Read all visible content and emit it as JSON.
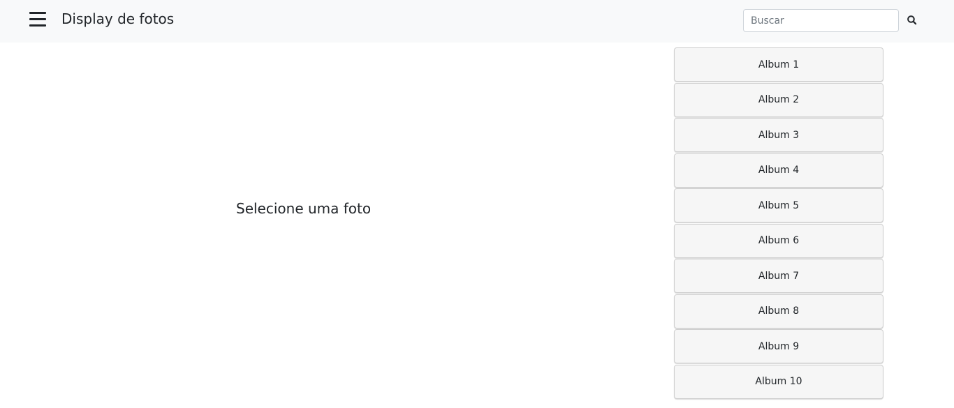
{
  "navbar": {
    "menu_icon": "hamburger-menu-icon",
    "title": "Display de fotos",
    "search": {
      "placeholder": "Buscar",
      "value": "",
      "icon": "search-icon"
    }
  },
  "main": {
    "placeholder_text": "Selecione uma foto"
  },
  "albums": [
    {
      "label": "Album 1"
    },
    {
      "label": "Album 2"
    },
    {
      "label": "Album 3"
    },
    {
      "label": "Album 4"
    },
    {
      "label": "Album 5"
    },
    {
      "label": "Album 6"
    },
    {
      "label": "Album 7"
    },
    {
      "label": "Album 8"
    },
    {
      "label": "Album 9"
    },
    {
      "label": "Album 10"
    }
  ],
  "colors": {
    "navbar_bg": "#f8f9fa",
    "text": "#212529",
    "album_button_bg": "#f6f6f6",
    "album_button_border": "#cfcfcf"
  }
}
